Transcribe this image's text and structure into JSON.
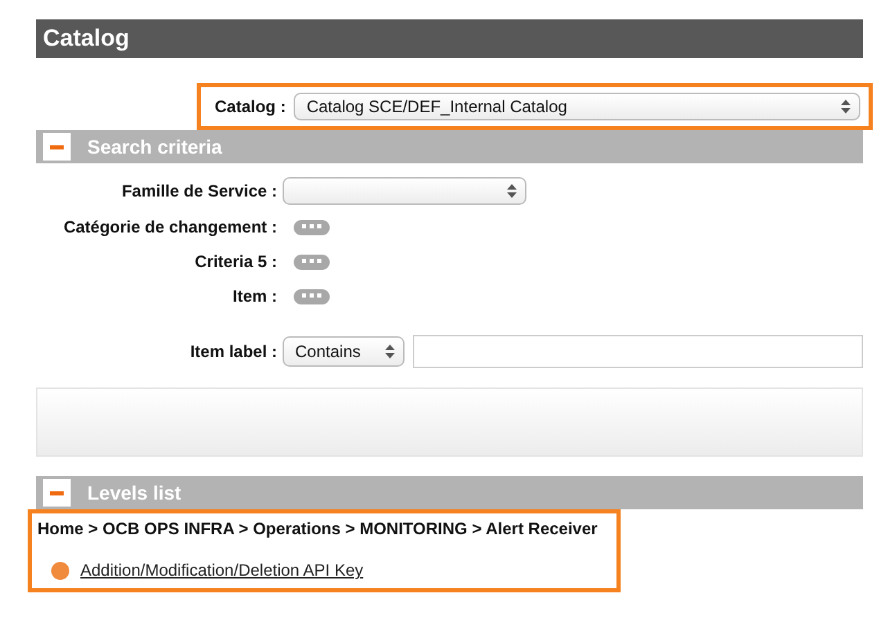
{
  "page_title": "Catalog",
  "catalog_selector": {
    "label": "Catalog :",
    "value": "Catalog SCE/DEF_Internal Catalog",
    "highlighted": true
  },
  "search_criteria": {
    "title": "Search criteria",
    "expanded": true,
    "fields": [
      {
        "kind": "select",
        "label": "Famille de Service :"
      },
      {
        "kind": "picker",
        "label": "Catégorie de changement :"
      },
      {
        "kind": "picker",
        "label": "Criteria 5 :"
      },
      {
        "kind": "picker",
        "label": "Item :"
      },
      {
        "kind": "text_filter",
        "label": "Item label :",
        "operator": "Contains"
      }
    ]
  },
  "levels_list": {
    "title": "Levels list",
    "expanded": true,
    "highlighted": true,
    "breadcrumb": "Home > OCB OPS INFRA > Operations > MONITORING > Alert Receiver",
    "items": [
      {
        "label": "Addition/Modification/Deletion API Key",
        "color": "#f08a3c"
      }
    ]
  }
}
